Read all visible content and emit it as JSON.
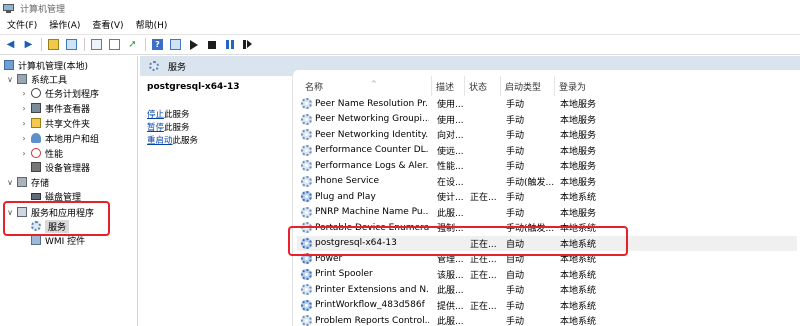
{
  "window": {
    "title": "计算机管理"
  },
  "menu": [
    "文件(F)",
    "操作(A)",
    "查看(V)",
    "帮助(H)"
  ],
  "toolbar": [
    "back-icon",
    "forward-icon",
    "up-folder-icon",
    "show-tree-icon",
    "properties-icon",
    "refresh-icon",
    "export-icon",
    "help-icon",
    "console-icon",
    "start-icon",
    "stop-icon",
    "pause-icon",
    "restart-icon"
  ],
  "tree": {
    "root": "计算机管理(本地)",
    "system_tools": "系统工具",
    "task_scheduler": "任务计划程序",
    "event_viewer": "事件查看器",
    "shared_folders": "共享文件夹",
    "local_users": "本地用户和组",
    "performance": "性能",
    "device_manager": "设备管理器",
    "storage": "存储",
    "disk_management": "磁盘管理",
    "services_apps": "服务和应用程序",
    "services": "服务",
    "wmi": "WMI 控件"
  },
  "panel": {
    "title": "服务"
  },
  "details": {
    "service_name": "postgresql-x64-13",
    "stop_link": "停止",
    "stop_suffix": "此服务",
    "pause_link": "暂停",
    "pause_suffix": "此服务",
    "restart_link": "重启动",
    "restart_suffix": "此服务"
  },
  "columns": {
    "name": "名称",
    "desc": "描述",
    "status": "状态",
    "startup": "启动类型",
    "logon": "登录为"
  },
  "services": [
    {
      "name": "Peer Name Resolution Pr...",
      "desc": "使用...",
      "status": "",
      "startup": "手动",
      "logon": "本地服务"
    },
    {
      "name": "Peer Networking Groupi...",
      "desc": "使用...",
      "status": "",
      "startup": "手动",
      "logon": "本地服务"
    },
    {
      "name": "Peer Networking Identity...",
      "desc": "向对...",
      "status": "",
      "startup": "手动",
      "logon": "本地服务"
    },
    {
      "name": "Performance Counter DL...",
      "desc": "使远...",
      "status": "",
      "startup": "手动",
      "logon": "本地服务"
    },
    {
      "name": "Performance Logs & Aler...",
      "desc": "性能...",
      "status": "",
      "startup": "手动",
      "logon": "本地服务"
    },
    {
      "name": "Phone Service",
      "desc": "在设...",
      "status": "",
      "startup": "手动(触发...",
      "logon": "本地服务"
    },
    {
      "name": "Plug and Play",
      "desc": "使计...",
      "status": "正在...",
      "startup": "手动",
      "logon": "本地系统"
    },
    {
      "name": "PNRP Machine Name Pu...",
      "desc": "此服...",
      "status": "",
      "startup": "手动",
      "logon": "本地服务"
    },
    {
      "name": "Portable Device Enumera...",
      "desc": "强制...",
      "status": "",
      "startup": "手动(触发...",
      "logon": "本地系统"
    },
    {
      "name": "postgresql-x64-13",
      "desc": "",
      "status": "正在...",
      "startup": "自动",
      "logon": "本地系统"
    },
    {
      "name": "Power",
      "desc": "管理...",
      "status": "正在...",
      "startup": "自动",
      "logon": "本地系统"
    },
    {
      "name": "Print Spooler",
      "desc": "该服...",
      "status": "正在...",
      "startup": "自动",
      "logon": "本地系统"
    },
    {
      "name": "Printer Extensions and N...",
      "desc": "此服...",
      "status": "",
      "startup": "手动",
      "logon": "本地系统"
    },
    {
      "name": "PrintWorkflow_483d586f",
      "desc": "提供...",
      "status": "正在...",
      "startup": "手动",
      "logon": "本地系统"
    },
    {
      "name": "Problem Reports Control...",
      "desc": "此服...",
      "status": "",
      "startup": "手动",
      "logon": "本地系统"
    }
  ]
}
